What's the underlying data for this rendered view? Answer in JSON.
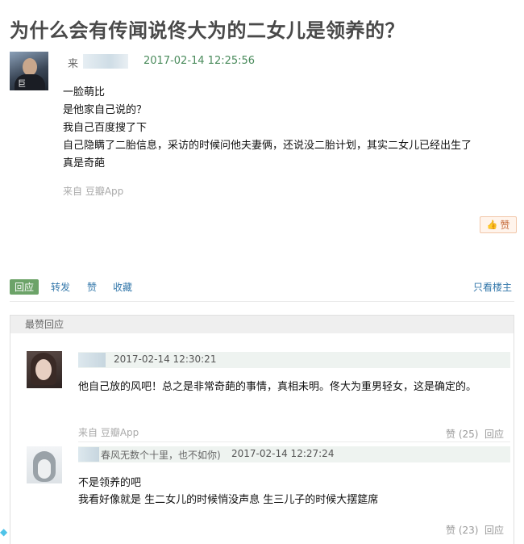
{
  "post": {
    "title": "为什么会有传闻说佟大为的二女儿是领养的？",
    "author_prefix": "来",
    "avatar_label": "巨",
    "date": "2017-02-14 12:25:56",
    "lines": [
      "一脸萌比",
      "是他家自己说的？",
      "我自己百度搜了下",
      "自己隐瞒了二胎信息，采访的时候问他夫妻俩，还说没二胎计划，其实二女儿已经出生了",
      "真是奇葩"
    ],
    "from_app": "来自 豆瓣App",
    "like_label": "赞"
  },
  "actions": {
    "reply": "回应",
    "forward": "转发",
    "like": "赞",
    "collect": "收藏",
    "only_op": "只看楼主"
  },
  "best_replies": {
    "header": "最赞回应",
    "items": [
      {
        "name": "",
        "date": "2017-02-14 12:30:21",
        "lines": [
          "他自己放的风吧！总之是非常奇葩的事情，真相未明。佟大为重男轻女，这是确定的。"
        ],
        "from_app": "来自 豆瓣App",
        "likes": "赞 (25)",
        "reply": "回应"
      },
      {
        "name": "春风无数个十里，也不如你)",
        "date": "2017-02-14 12:27:24",
        "lines": [
          "不是领养的吧",
          "我看好像就是 生二女儿的时候悄没声息 生三儿子的时候大摆筵席"
        ],
        "from_app": "",
        "likes": "赞 (23)",
        "reply": "回应"
      }
    ]
  }
}
